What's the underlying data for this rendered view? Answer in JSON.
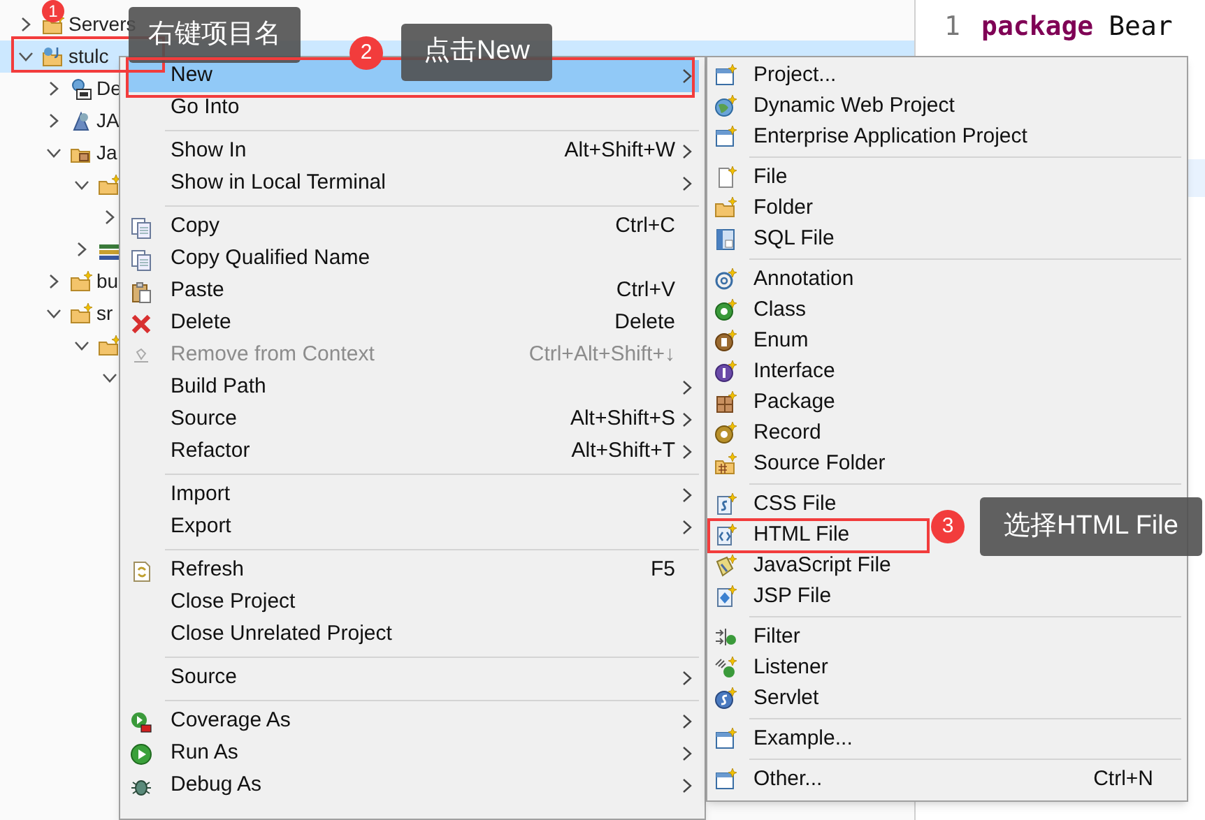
{
  "explorer": {
    "tree": [
      {
        "label": "Servers",
        "expanded": false,
        "selected": false
      },
      {
        "label": "stulc",
        "expanded": true,
        "selected": true,
        "children": [
          {
            "label": "De",
            "expanded": false,
            "selected": false
          },
          {
            "label": "JA",
            "expanded": false,
            "selected": false
          },
          {
            "label": "Ja",
            "expanded": true,
            "selected": false,
            "children": [
              {
                "expanded": true,
                "selected": false,
                "children": [
                  {
                    "expanded": false,
                    "selected": false
                  }
                ]
              },
              {
                "expanded": false,
                "selected": false
              }
            ]
          },
          {
            "label": "bu",
            "expanded": false,
            "selected": false
          },
          {
            "label": "sr",
            "expanded": true,
            "selected": false,
            "children": [
              {
                "expanded": true,
                "selected": false,
                "children": [
                  {
                    "expanded": true,
                    "selected": false
                  }
                ]
              }
            ]
          }
        ]
      }
    ]
  },
  "editor": {
    "lines": [
      {
        "number": "1",
        "keyword": "package",
        "text": "Bear"
      }
    ]
  },
  "context_menu": {
    "groups": [
      [
        {
          "label": "New",
          "has_submenu": true,
          "selected": true,
          "disabled": false
        },
        {
          "label": "Go Into",
          "has_submenu": false,
          "selected": false,
          "disabled": false
        }
      ],
      [
        {
          "label": "Show In",
          "shortcut": "Alt+Shift+W",
          "has_submenu": true,
          "selected": false,
          "disabled": false
        },
        {
          "label": "Show in Local Terminal",
          "has_submenu": true,
          "selected": false,
          "disabled": false
        }
      ],
      [
        {
          "label": "Copy",
          "shortcut": "Ctrl+C",
          "has_submenu": false,
          "selected": false,
          "disabled": false
        },
        {
          "label": "Copy Qualified Name",
          "has_submenu": false,
          "selected": false,
          "disabled": false
        },
        {
          "label": "Paste",
          "shortcut": "Ctrl+V",
          "has_submenu": false,
          "selected": false,
          "disabled": false
        },
        {
          "label": "Delete",
          "shortcut": "Delete",
          "has_submenu": false,
          "selected": false,
          "disabled": false
        },
        {
          "label": "Remove from Context",
          "shortcut": "Ctrl+Alt+Shift+↓",
          "has_submenu": false,
          "selected": false,
          "disabled": true
        },
        {
          "label": "Build Path",
          "has_submenu": true,
          "selected": false,
          "disabled": false
        },
        {
          "label": "Source",
          "shortcut": "Alt+Shift+S",
          "has_submenu": true,
          "selected": false,
          "disabled": false
        },
        {
          "label": "Refactor",
          "shortcut": "Alt+Shift+T",
          "has_submenu": true,
          "selected": false,
          "disabled": false
        }
      ],
      [
        {
          "label": "Import",
          "has_submenu": true,
          "selected": false,
          "disabled": false
        },
        {
          "label": "Export",
          "has_submenu": true,
          "selected": false,
          "disabled": false
        }
      ],
      [
        {
          "label": "Refresh",
          "shortcut": "F5",
          "has_submenu": false,
          "selected": false,
          "disabled": false
        },
        {
          "label": "Close Project",
          "has_submenu": false,
          "selected": false,
          "disabled": false
        },
        {
          "label": "Close Unrelated Project",
          "has_submenu": false,
          "selected": false,
          "disabled": false
        }
      ],
      [
        {
          "label": "Source",
          "has_submenu": true,
          "selected": false,
          "disabled": false
        }
      ],
      [
        {
          "label": "Coverage As",
          "has_submenu": true,
          "selected": false,
          "disabled": false
        },
        {
          "label": "Run As",
          "has_submenu": true,
          "selected": false,
          "disabled": false
        },
        {
          "label": "Debug As",
          "has_submenu": true,
          "selected": false,
          "disabled": false
        }
      ]
    ]
  },
  "new_submenu": {
    "groups": [
      [
        {
          "label": "Project..."
        },
        {
          "label": "Dynamic Web Project"
        },
        {
          "label": "Enterprise Application Project"
        }
      ],
      [
        {
          "label": "File"
        },
        {
          "label": "Folder"
        },
        {
          "label": "SQL File"
        }
      ],
      [
        {
          "label": "Annotation"
        },
        {
          "label": "Class"
        },
        {
          "label": "Enum"
        },
        {
          "label": "Interface"
        },
        {
          "label": "Package"
        },
        {
          "label": "Record"
        },
        {
          "label": "Source Folder"
        }
      ],
      [
        {
          "label": "CSS File"
        },
        {
          "label": "HTML File"
        },
        {
          "label": "JavaScript File"
        },
        {
          "label": "JSP File"
        }
      ],
      [
        {
          "label": "Filter"
        },
        {
          "label": "Listener"
        },
        {
          "label": "Servlet"
        }
      ],
      [
        {
          "label": "Example..."
        }
      ],
      [
        {
          "label": "Other...",
          "shortcut": "Ctrl+N"
        }
      ]
    ]
  },
  "callouts": [
    {
      "number": "1",
      "text": "右键项目名"
    },
    {
      "number": "2",
      "text": "点击New"
    },
    {
      "number": "3",
      "text": "选择HTML File"
    }
  ]
}
